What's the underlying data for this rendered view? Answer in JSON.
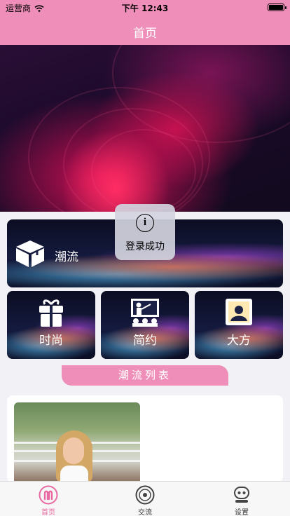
{
  "status_bar": {
    "carrier": "运营商",
    "time": "下午 12:43"
  },
  "nav": {
    "title": "首页"
  },
  "categories": {
    "main": {
      "label": "潮流",
      "icon": "box-icon"
    },
    "items": [
      {
        "label": "时尚",
        "icon": "gift-icon"
      },
      {
        "label": "简约",
        "icon": "presentation-icon"
      },
      {
        "label": "大方",
        "icon": "contact-book-icon"
      }
    ]
  },
  "toast": {
    "message": "登录成功",
    "icon": "info-icon"
  },
  "section": {
    "title": "潮流列表"
  },
  "list": [
    {
      "image": "woman-portrait-photo"
    }
  ],
  "tabbar": {
    "items": [
      {
        "label": "首页",
        "icon": "home-icon",
        "active": true
      },
      {
        "label": "交流",
        "icon": "disc-icon",
        "active": false
      },
      {
        "label": "设置",
        "icon": "robot-icon",
        "active": false
      }
    ]
  },
  "colors": {
    "accent": "#ef8fb9",
    "active_tab": "#e96aa2"
  }
}
